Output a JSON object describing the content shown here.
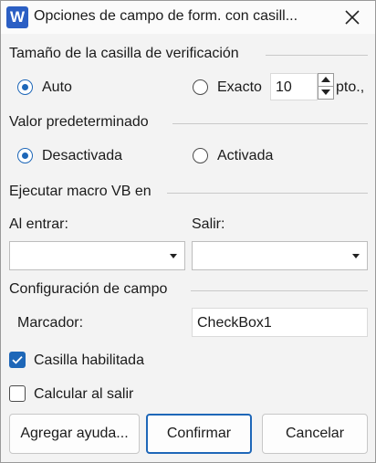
{
  "window": {
    "app_icon_letter": "W",
    "title": "Opciones de campo de form. con casill..."
  },
  "checkbox_size": {
    "header": "Tamaño de la casilla de verificación",
    "auto_label": "Auto",
    "auto_selected": true,
    "exact_label": "Exacto",
    "exact_selected": false,
    "exact_value": "10",
    "unit": "pto.,"
  },
  "default_value": {
    "header": "Valor predeterminado",
    "off_label": "Desactivada",
    "off_selected": true,
    "on_label": "Activada",
    "on_selected": false
  },
  "run_macro": {
    "header": "Ejecutar macro VB en",
    "on_entry_label": "Al entrar:",
    "on_entry_value": "",
    "on_exit_label": "Salir:",
    "on_exit_value": ""
  },
  "field_settings": {
    "header": "Configuración de campo",
    "bookmark_label": "Marcador:",
    "bookmark_value": "CheckBox1",
    "enabled_label": "Casilla habilitada",
    "enabled_checked": true,
    "calc_on_exit_label": "Calcular al salir",
    "calc_on_exit_checked": false
  },
  "buttons": {
    "add_help": "Agregar ayuda...",
    "ok": "Confirmar",
    "cancel": "Cancelar"
  },
  "colors": {
    "accent": "#1e67b8",
    "app_icon": "#2b5fc4"
  },
  "icons": {
    "app": "word-app-icon",
    "close": "close-icon",
    "spin_up": "spin-up-arrow-icon",
    "spin_down": "spin-down-arrow-icon",
    "dropdown": "chevron-down-icon",
    "check": "checkmark-icon"
  }
}
